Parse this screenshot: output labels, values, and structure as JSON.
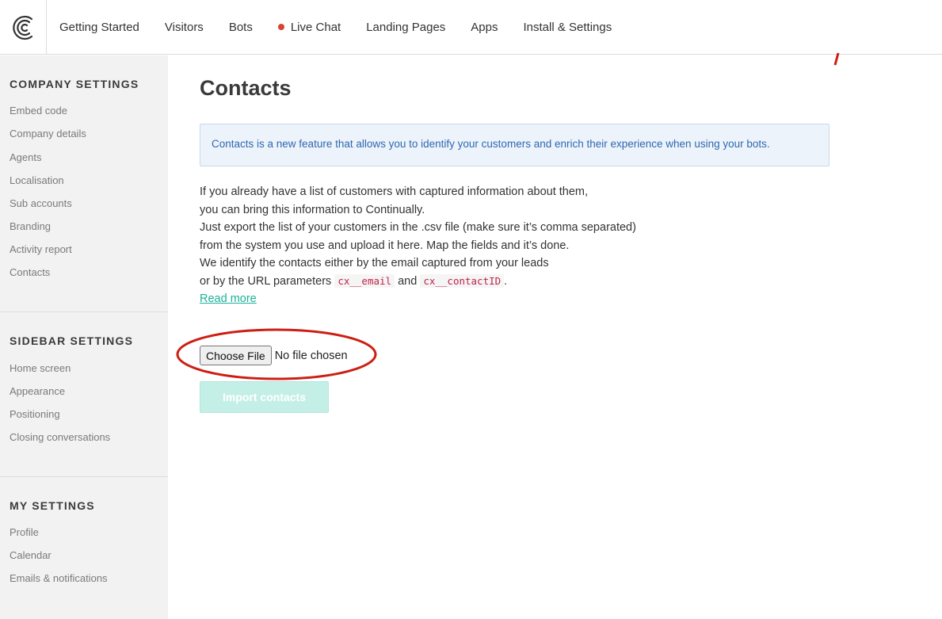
{
  "nav": {
    "items": [
      {
        "label": "Getting Started",
        "dot": false
      },
      {
        "label": "Visitors",
        "dot": false
      },
      {
        "label": "Bots",
        "dot": false
      },
      {
        "label": "Live Chat",
        "dot": true
      },
      {
        "label": "Landing Pages",
        "dot": false
      },
      {
        "label": "Apps",
        "dot": false
      },
      {
        "label": "Install & Settings",
        "dot": false
      }
    ]
  },
  "sidebar": {
    "company": {
      "title": "COMPANY SETTINGS",
      "items": [
        "Embed code",
        "Company details",
        "Agents",
        "Localisation",
        "Sub accounts",
        "Branding",
        "Activity report",
        "Contacts"
      ]
    },
    "sidebar_settings": {
      "title": "SIDEBAR SETTINGS",
      "items": [
        "Home screen",
        "Appearance",
        "Positioning",
        "Closing conversations"
      ]
    },
    "my": {
      "title": "MY SETTINGS",
      "items": [
        "Profile",
        "Calendar",
        "Emails & notifications"
      ]
    }
  },
  "main": {
    "title": "Contacts",
    "info": "Contacts is a new feature that allows you to identify your customers and enrich their experience when using your bots.",
    "desc": {
      "line1": "If you already have a list of customers with captured information about them,",
      "line2": "you can bring this information to Continually.",
      "line3": "Just export the list of your customers in the .csv file (make sure it’s comma separated)",
      "line4": "from the system you use and upload it here. Map the fields and it’s done.",
      "line5": "We identify the contacts either by the email captured from your leads",
      "line6_prefix": "or by the URL parameters",
      "code1": "cx__email",
      "and": "and",
      "code2": "cx__contactID",
      "period": ".",
      "read_more": "Read more"
    },
    "file": {
      "button": "Choose File",
      "status": "No file chosen"
    },
    "import_button": "Import contacts"
  },
  "colors": {
    "accent": "#19b39a",
    "annotation": "#cc1f14",
    "info_text": "#2f68b0",
    "live_dot": "#d9413a"
  },
  "icons": {
    "logo": "continually-c-logo"
  }
}
